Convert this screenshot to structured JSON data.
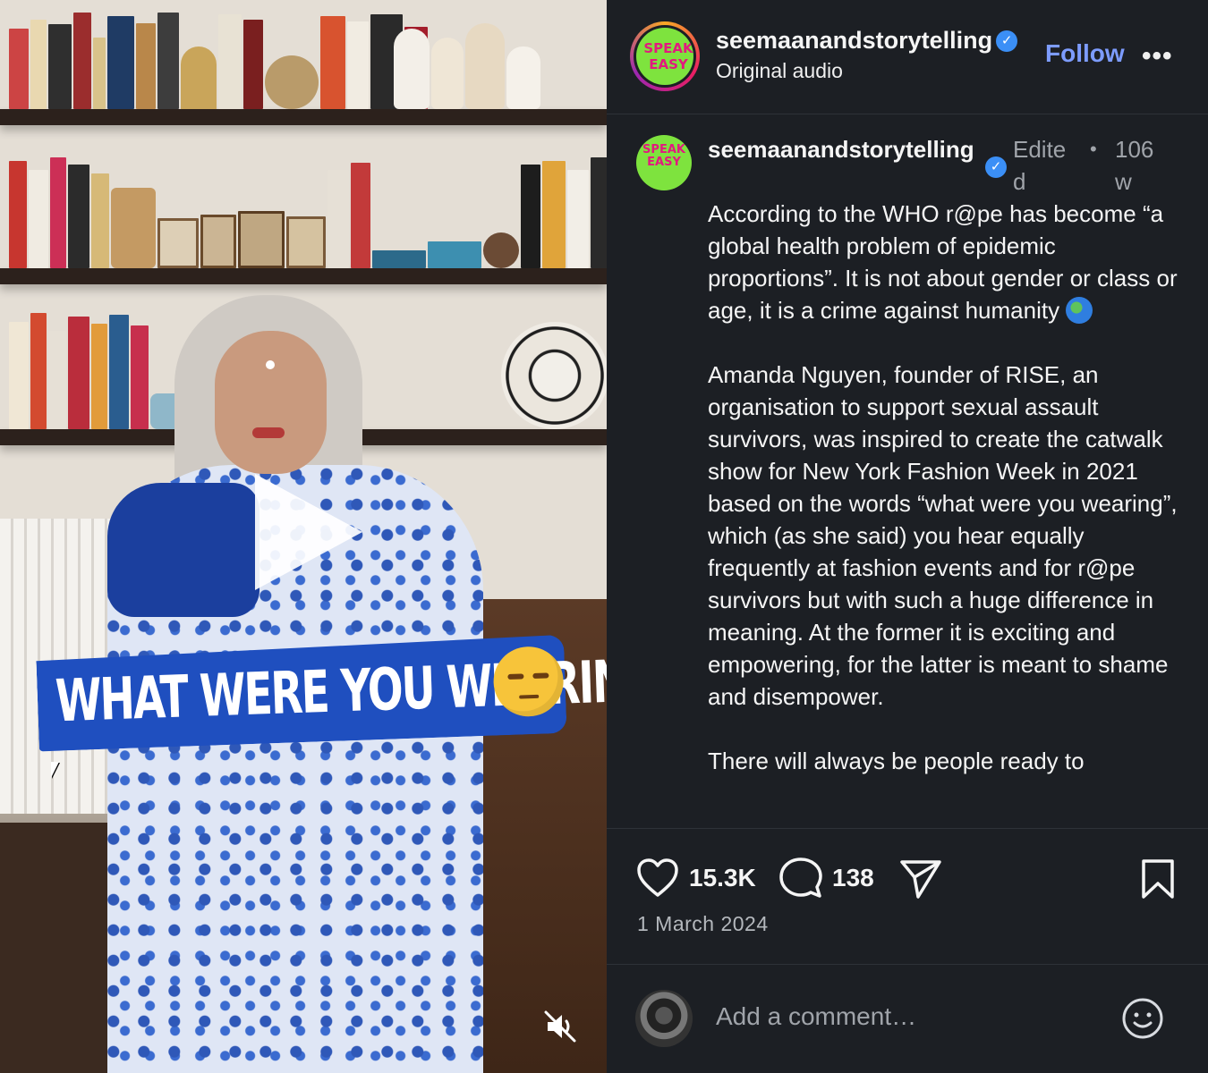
{
  "video": {
    "overlay_text": "WHAT WERE YOU WEARING?",
    "overlay_emoji": "unamused-face",
    "play_icon": "play-icon",
    "mute_icon": "muted-speaker-icon"
  },
  "header": {
    "username": "seemaanandstorytelling",
    "verified": true,
    "subtitle": "Original audio",
    "follow_label": "Follow",
    "more_label": "•••",
    "avatar_text_top": "SPEAK",
    "avatar_text_bottom": "EASY"
  },
  "post": {
    "username": "seemaanandstorytelling",
    "edited": "Edited",
    "separator": "•",
    "age": "106 w",
    "caption_p1": "According to the WHO r@pe has become “a global health problem of epidemic proportions”. It is not about gender or class or age, it is a crime against humanity",
    "caption_p1_emoji": "globe-emoji",
    "caption_p2": "Amanda Nguyen, founder of RISE, an organisation to support sexual assault survivors, was inspired to create the catwalk show for New York Fashion Week in 2021 based on the words “what were you wearing”, which (as she said) you hear equally frequently at fashion events and for r@pe survivors but with such a huge difference in meaning. At the former it is exciting and empowering, for the latter is meant to shame and disempower.",
    "caption_p3": "There will always be people ready to"
  },
  "actions": {
    "likes": "15.3K",
    "comments": "138",
    "date": "1 March 2024",
    "icons": [
      "heart-icon",
      "comment-icon",
      "share-icon",
      "bookmark-icon"
    ]
  },
  "comment_box": {
    "placeholder": "Add a comment…",
    "emoji_icon": "smiley-icon"
  },
  "colors": {
    "panel_bg": "#1c1f24",
    "follow": "#7d9cff",
    "verified": "#3b8ff6",
    "banner": "#1f4fbf"
  }
}
